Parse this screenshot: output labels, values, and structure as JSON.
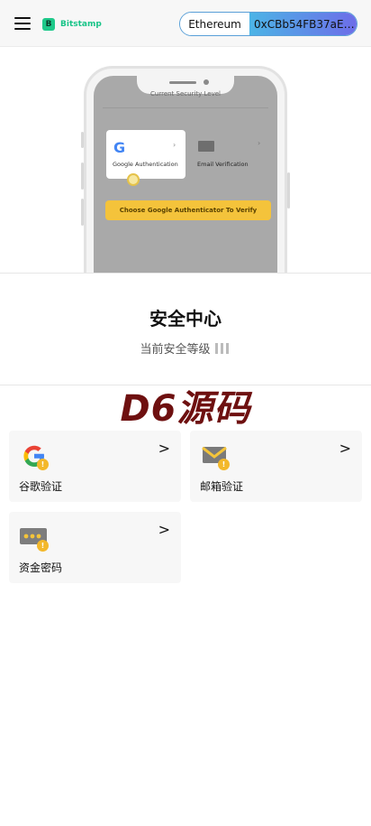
{
  "header": {
    "brand": "Bitstamp",
    "brand_mark": "B",
    "network": "Ethereum",
    "address": "0xCBb54FB37aE…",
    "colors": {
      "brand": "#1ec98a",
      "wallet_gradient_start": "#4cb4e6",
      "wallet_gradient_end": "#6d6de8"
    }
  },
  "mockup": {
    "security_level": "Current Security Level",
    "google_auth": "Google Authentication",
    "email_verification": "Email Verification",
    "choose_button": "Choose Google Authenticator To Verify"
  },
  "security": {
    "title": "安全中心",
    "level_label": "当前安全等级",
    "level_bars": 3
  },
  "watermark": "D6源码",
  "options": [
    {
      "label": "谷歌验证",
      "icon": "google-icon"
    },
    {
      "label": "邮箱验证",
      "icon": "email-icon"
    },
    {
      "label": "资金密码",
      "icon": "fund-password-icon"
    }
  ]
}
